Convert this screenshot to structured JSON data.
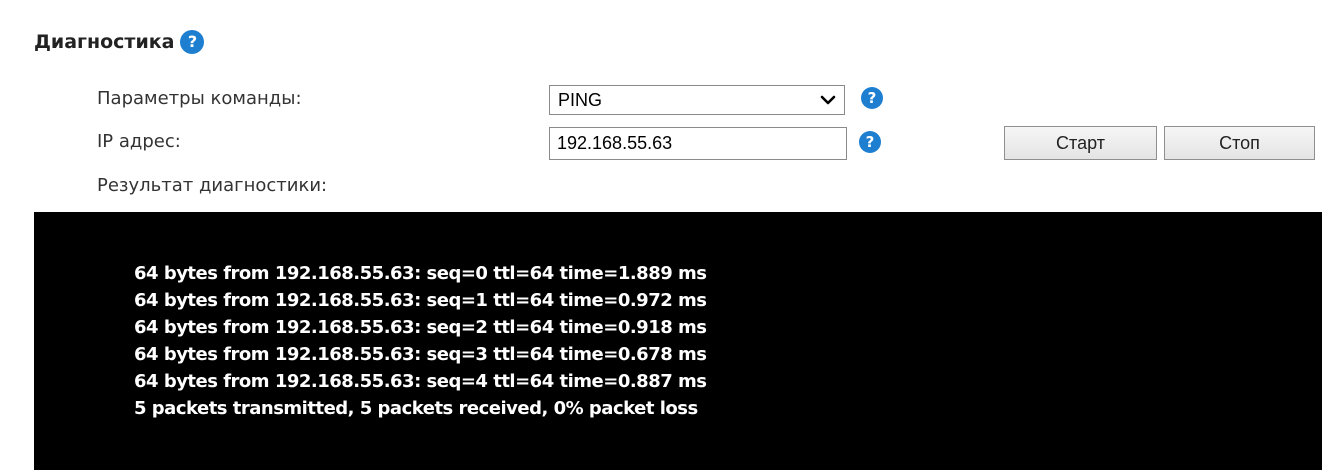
{
  "section": {
    "title": "Диагностика",
    "help_icon": "question-mark-icon"
  },
  "form": {
    "command_label": "Параметры команды:",
    "command_value": "PING",
    "ip_label": "IP адрес:",
    "ip_value": "192.168.55.63",
    "result_label": "Результат диагностики:",
    "help_glyph": "?"
  },
  "buttons": {
    "start_label": "Старт",
    "stop_label": "Стоп"
  },
  "console": {
    "lines": [
      "64 bytes from 192.168.55.63: seq=0 ttl=64 time=1.889 ms",
      "64 bytes from 192.168.55.63: seq=1 ttl=64 time=0.972 ms",
      "64 bytes from 192.168.55.63: seq=2 ttl=64 time=0.918 ms",
      "64 bytes from 192.168.55.63: seq=3 ttl=64 time=0.678 ms",
      "64 bytes from 192.168.55.63: seq=4 ttl=64 time=0.887 ms",
      "5 packets transmitted, 5 packets received, 0% packet loss"
    ]
  },
  "colors": {
    "help_icon": "#1e7fd0",
    "console_background": "#000000",
    "console_text": "#ffffff"
  }
}
